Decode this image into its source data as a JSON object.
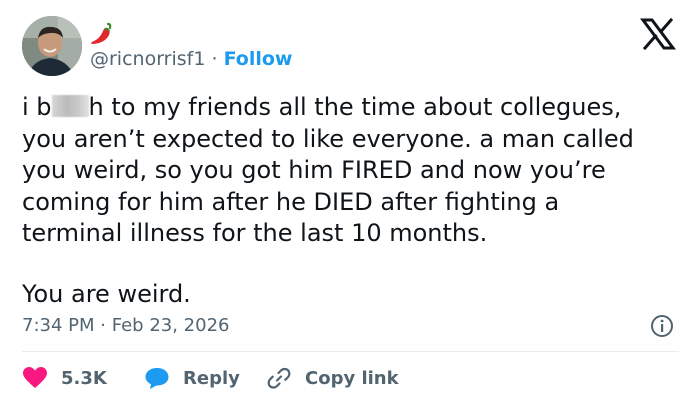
{
  "tweet": {
    "handle": "@ricnorrisf1",
    "separator": "·",
    "follow_label": "Follow",
    "text_line1_start": "i b",
    "text_line1_end": "h to my friends all the time about collegues,",
    "text_rest": "you aren’t expected to like everyone. a man called\nyou weird, so you got him FIRED and now you’re\ncoming for him after he DIED after fighting a\nterminal illness for the last 10 months.",
    "text_closing": "You are weird.",
    "time": "7:34 PM",
    "date": "Feb 23, 2026"
  },
  "actions": {
    "likes": "5.3K",
    "reply_label": "Reply",
    "copy_label": "Copy link"
  },
  "colors": {
    "accent": "#1d9bf0",
    "like": "#f91880",
    "text": "#0f1419",
    "muted": "#536471"
  }
}
